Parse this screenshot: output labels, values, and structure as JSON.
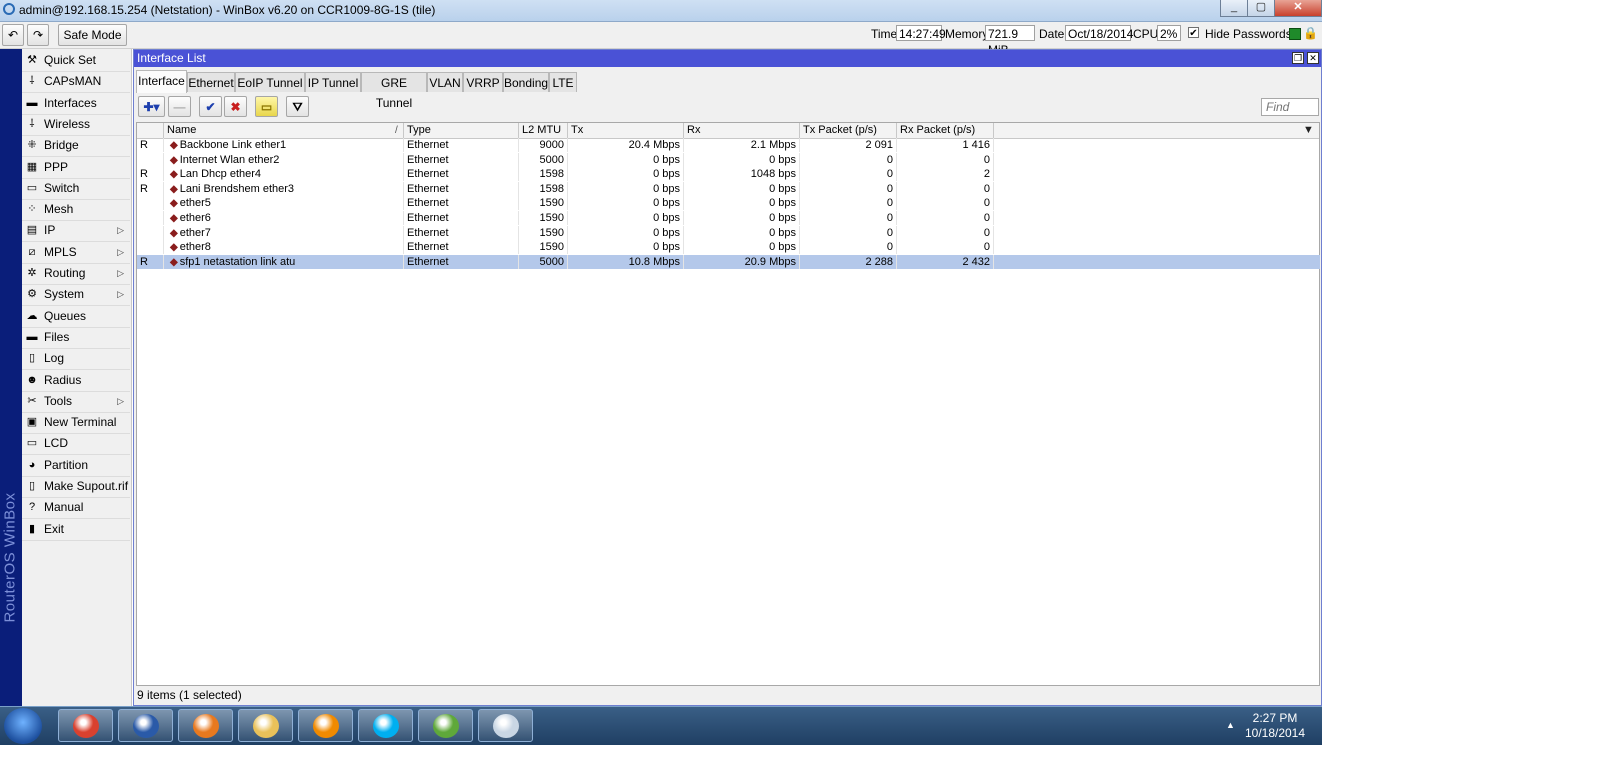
{
  "window": {
    "title": "admin@192.168.15.254 (Netstation) - WinBox v6.20 on CCR1009-8G-1S (tile)",
    "min": "_",
    "max": "▢",
    "close": "✕"
  },
  "toolbar": {
    "undo": "↶",
    "redo": "↷",
    "safe_mode": "Safe Mode",
    "time_label": "Time:",
    "time_value": "14:27:49",
    "memory_label": "Memory:",
    "memory_value": "721.9 MiB",
    "date_label": "Date:",
    "date_value": "Oct/18/2014",
    "cpu_label": "CPU:",
    "cpu_value": "2%",
    "hide_passwords": "Hide Passwords",
    "hide_passwords_checked": true
  },
  "brand": "RouterOS WinBox",
  "menu": [
    {
      "label": "Quick Set",
      "icon": "quickset-icon",
      "glyph": "⚒",
      "sub": false
    },
    {
      "label": "CAPsMAN",
      "icon": "capsman-icon",
      "glyph": "⸸",
      "sub": false
    },
    {
      "label": "Interfaces",
      "icon": "interfaces-icon",
      "glyph": "▬",
      "sub": false
    },
    {
      "label": "Wireless",
      "icon": "wireless-icon",
      "glyph": "⸸",
      "sub": false
    },
    {
      "label": "Bridge",
      "icon": "bridge-icon",
      "glyph": "⁜",
      "sub": false
    },
    {
      "label": "PPP",
      "icon": "ppp-icon",
      "glyph": "▦",
      "sub": false
    },
    {
      "label": "Switch",
      "icon": "switch-icon",
      "glyph": "▭",
      "sub": false
    },
    {
      "label": "Mesh",
      "icon": "mesh-icon",
      "glyph": "⁘",
      "sub": false
    },
    {
      "label": "IP",
      "icon": "ip-icon",
      "glyph": "▤",
      "sub": true
    },
    {
      "label": "MPLS",
      "icon": "mpls-icon",
      "glyph": "⧄",
      "sub": true
    },
    {
      "label": "Routing",
      "icon": "routing-icon",
      "glyph": "✲",
      "sub": true
    },
    {
      "label": "System",
      "icon": "system-icon",
      "glyph": "⚙",
      "sub": true
    },
    {
      "label": "Queues",
      "icon": "queues-icon",
      "glyph": "☁",
      "sub": false
    },
    {
      "label": "Files",
      "icon": "files-icon",
      "glyph": "▬",
      "sub": false
    },
    {
      "label": "Log",
      "icon": "log-icon",
      "glyph": "▯",
      "sub": false
    },
    {
      "label": "Radius",
      "icon": "radius-icon",
      "glyph": "☻",
      "sub": false
    },
    {
      "label": "Tools",
      "icon": "tools-icon",
      "glyph": "✂",
      "sub": true
    },
    {
      "label": "New Terminal",
      "icon": "terminal-icon",
      "glyph": "▣",
      "sub": false
    },
    {
      "label": "LCD",
      "icon": "lcd-icon",
      "glyph": "▭",
      "sub": false
    },
    {
      "label": "Partition",
      "icon": "partition-icon",
      "glyph": "◕",
      "sub": false
    },
    {
      "label": "Make Supout.rif",
      "icon": "supout-icon",
      "glyph": "▯",
      "sub": false
    },
    {
      "label": "Manual",
      "icon": "manual-icon",
      "glyph": "?",
      "sub": false
    },
    {
      "label": "Exit",
      "icon": "exit-icon",
      "glyph": "▮",
      "sub": false
    }
  ],
  "interface_window": {
    "title": "Interface List",
    "restore": "❐",
    "close": "✕",
    "tabs": [
      "Interface",
      "Ethernet",
      "EoIP Tunnel",
      "IP Tunnel",
      "GRE Tunnel",
      "VLAN",
      "VRRP",
      "Bonding",
      "LTE"
    ],
    "active_tab": 0,
    "actions": {
      "add": "✚▾",
      "remove": "—",
      "enable": "✔",
      "disable": "✖",
      "comment": "▭",
      "filter": "⛛"
    },
    "find_placeholder": "Find",
    "columns": [
      "",
      "Name",
      "Type",
      "L2 MTU",
      "Tx",
      "Rx",
      "Tx Packet (p/s)",
      "Rx Packet (p/s)"
    ],
    "sort_indicator": "/",
    "column_menu": "▼",
    "rows": [
      {
        "flag": "R",
        "name": "Backbone Link ether1",
        "type": "Ethernet",
        "mtu": "9000",
        "tx": "20.4 Mbps",
        "rx": "2.1 Mbps",
        "txp": "2 091",
        "rxp": "1 416",
        "selected": false
      },
      {
        "flag": "",
        "name": "Internet Wlan ether2",
        "type": "Ethernet",
        "mtu": "5000",
        "tx": "0 bps",
        "rx": "0 bps",
        "txp": "0",
        "rxp": "0",
        "selected": false
      },
      {
        "flag": "R",
        "name": "Lan Dhcp ether4",
        "type": "Ethernet",
        "mtu": "1598",
        "tx": "0 bps",
        "rx": "1048 bps",
        "txp": "0",
        "rxp": "2",
        "selected": false
      },
      {
        "flag": "R",
        "name": "Lani Brendshem ether3",
        "type": "Ethernet",
        "mtu": "1598",
        "tx": "0 bps",
        "rx": "0 bps",
        "txp": "0",
        "rxp": "0",
        "selected": false
      },
      {
        "flag": "",
        "name": "ether5",
        "type": "Ethernet",
        "mtu": "1590",
        "tx": "0 bps",
        "rx": "0 bps",
        "txp": "0",
        "rxp": "0",
        "selected": false
      },
      {
        "flag": "",
        "name": "ether6",
        "type": "Ethernet",
        "mtu": "1590",
        "tx": "0 bps",
        "rx": "0 bps",
        "txp": "0",
        "rxp": "0",
        "selected": false
      },
      {
        "flag": "",
        "name": "ether7",
        "type": "Ethernet",
        "mtu": "1590",
        "tx": "0 bps",
        "rx": "0 bps",
        "txp": "0",
        "rxp": "0",
        "selected": false
      },
      {
        "flag": "",
        "name": "ether8",
        "type": "Ethernet",
        "mtu": "1590",
        "tx": "0 bps",
        "rx": "0 bps",
        "txp": "0",
        "rxp": "0",
        "selected": false
      },
      {
        "flag": "R",
        "name": "sfp1 netastation link atu",
        "type": "Ethernet",
        "mtu": "5000",
        "tx": "10.8 Mbps",
        "rx": "20.9 Mbps",
        "txp": "2 288",
        "rxp": "2 432",
        "selected": true
      }
    ],
    "status": "9 items (1 selected)"
  },
  "taskbar": {
    "apps": [
      {
        "name": "chrome-icon",
        "color": "#d9412f"
      },
      {
        "name": "winbox-icon",
        "color": "#2a5aa8"
      },
      {
        "name": "firefox-icon",
        "color": "#e8791f"
      },
      {
        "name": "explorer-icon",
        "color": "#e9c15a"
      },
      {
        "name": "vlc-icon",
        "color": "#f08a00"
      },
      {
        "name": "skype-icon",
        "color": "#00aff0"
      },
      {
        "name": "utorrent-icon",
        "color": "#5fa83a"
      },
      {
        "name": "paint-icon",
        "color": "#c9d6e4"
      }
    ],
    "tray_arrow": "▲",
    "time": "2:27 PM",
    "date": "10/18/2014"
  },
  "colors": {
    "window_title": "#4a52d6",
    "brand_strip": "#0a1e7a",
    "selection": "#b4c8ea"
  }
}
